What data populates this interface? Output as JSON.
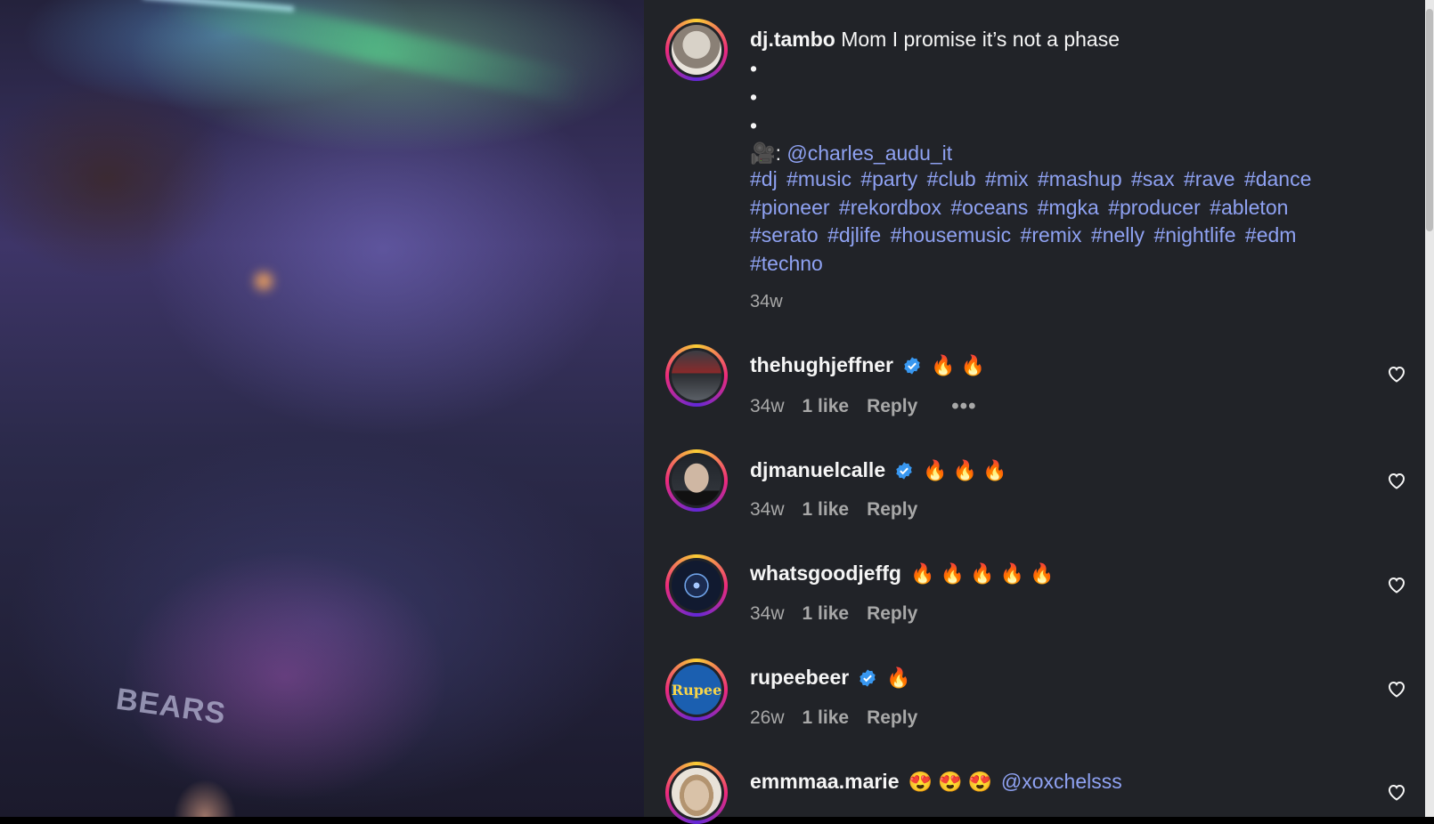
{
  "post": {
    "username": "dj.tambo",
    "caption": "Mom I promise it’s not a phase",
    "bullets": [
      "•",
      "•",
      "•"
    ],
    "credit_prefix": "🎥:",
    "credit_mention": "@charles_audu_it",
    "hashtags": [
      "#dj",
      "#music",
      "#party",
      "#club",
      "#mix",
      "#mashup",
      "#sax",
      "#rave",
      "#dance",
      "#pioneer",
      "#rekordbox",
      "#oceans",
      "#mgka",
      "#producer",
      "#ableton",
      "#serato",
      "#djlife",
      "#housemusic",
      "#remix",
      "#nelly",
      "#nightlife",
      "#edm",
      "#techno"
    ],
    "age": "34w"
  },
  "comments": [
    {
      "username": "thehughjeffner",
      "verified": true,
      "text": "🔥 🔥",
      "age": "34w",
      "likes": "1 like",
      "reply": "Reply",
      "more": "•••"
    },
    {
      "username": "djmanuelcalle",
      "verified": true,
      "text": "🔥 🔥 🔥",
      "age": "34w",
      "likes": "1 like",
      "reply": "Reply"
    },
    {
      "username": "whatsgoodjeffg",
      "verified": false,
      "text": "🔥 🔥 🔥 🔥 🔥",
      "age": "34w",
      "likes": "1 like",
      "reply": "Reply"
    },
    {
      "username": "rupeebeer",
      "verified": true,
      "text": "🔥",
      "age": "26w",
      "likes": "1 like",
      "reply": "Reply",
      "avatar_text": "Rupee"
    },
    {
      "username": "emmmaa.marie",
      "verified": false,
      "text": "😍 😍 😍",
      "mention": "@xoxchelsss"
    }
  ],
  "media": {
    "shirt_text": "BEARS"
  },
  "colors": {
    "panel_bg": "#212328",
    "link": "#8fa2f2",
    "muted": "#a8a8a8",
    "verified": "#3897f0"
  }
}
